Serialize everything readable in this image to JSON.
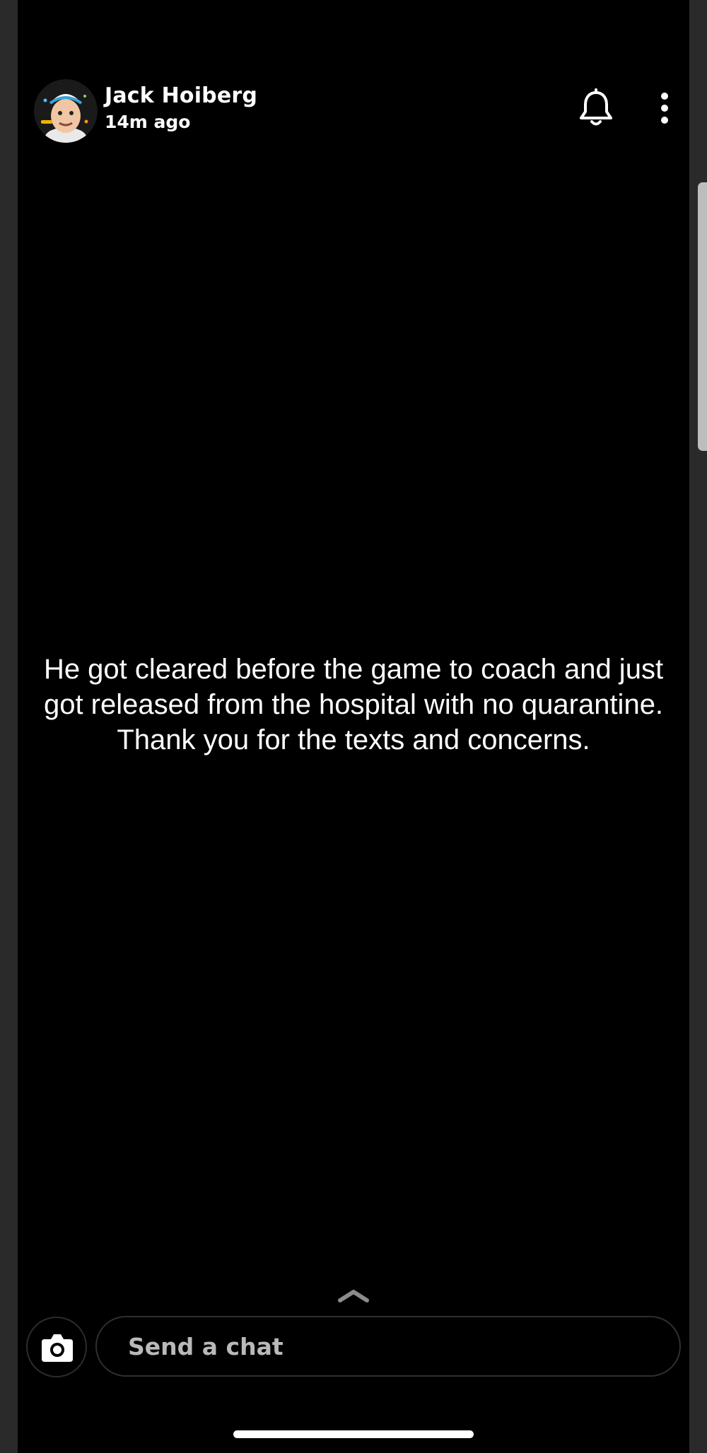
{
  "header": {
    "user_name": "Jack Hoiberg",
    "timestamp": "14m ago",
    "avatar_icon": "bitmoji-avatar-icon",
    "notification_icon": "bell-icon",
    "more_icon": "more-vertical-icon"
  },
  "story": {
    "text": "He got cleared before the game to coach and just got released from the hospital with no quarantine. Thank you for the texts and concerns."
  },
  "footer": {
    "camera_icon": "camera-icon",
    "chat_placeholder": "Send a chat",
    "swipe_icon": "chevron-up-icon"
  },
  "colors": {
    "background": "#000000",
    "text": "#ffffff",
    "placeholder": "#b9b9b9"
  }
}
